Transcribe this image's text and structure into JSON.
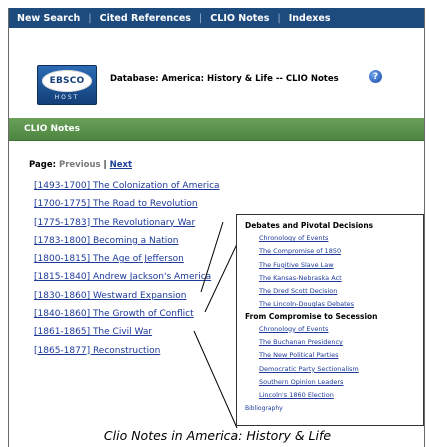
{
  "topnav": {
    "items": [
      "New Search",
      "Cited References",
      "CLIO Notes",
      "Indexes"
    ]
  },
  "header": {
    "logo_text": "EBSCO",
    "logo_sub": "HOST",
    "database_label": "Database: America: History & Life -- CLIO Notes",
    "help_glyph": "?"
  },
  "section": {
    "title": "CLIO Notes"
  },
  "pager": {
    "label": "Page:",
    "previous": "Previous",
    "separator": "|",
    "next": "Next"
  },
  "eras": [
    "[1493-1700] The Colonization of America",
    "[1700-1775] The Road to Revolution",
    "[1775-1783] The Revolutionary War",
    "[1783-1800] Becoming a Nation",
    "[1800-1815] The Age of Jefferson",
    "[1815-1840] Andrew Jackson's America",
    "[1830-1860] Westward Expansion",
    "[1840-1860] The Growth of Conflict",
    "[1861-1865] The Civil War",
    "[1865-1877] Reconstruction"
  ],
  "popup": {
    "section1_title": "Debates and Pivotal Decisions",
    "section1_items": [
      "Chronology of Events",
      "The Compromise of 1850",
      "The Fugitive Slave Law",
      "The Kansas-Nebraska Act",
      "The Dred Scott Decision",
      "The Lincoln-Douglas Debates"
    ],
    "section2_title": "From Compromise to Secession",
    "section2_items": [
      "Chronology of Events",
      "The Buchanan Presidency",
      "The New Political Parties",
      "Democratic Party Sectionalism",
      "Southern Opinion Leaders",
      "Lincoln's 1860 Election"
    ],
    "bibliography": "Bibliography"
  },
  "caption": "Clio Notes in America: History & Life",
  "colors": {
    "nav_bg": "#1d4b7e",
    "green_bar": "#5a9249",
    "link": "#1d3a9a"
  }
}
